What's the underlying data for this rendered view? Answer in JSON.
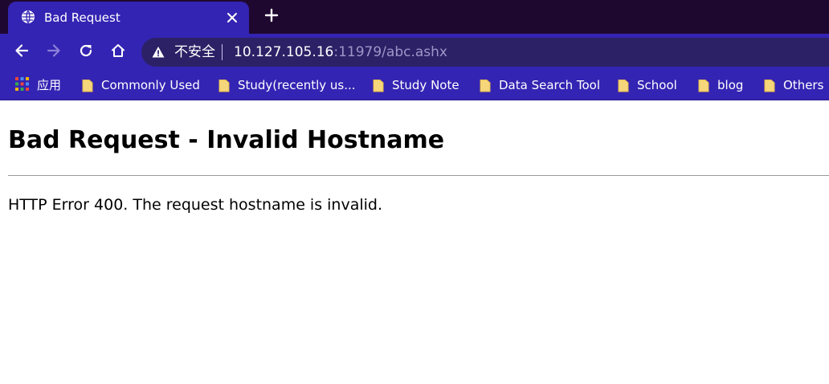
{
  "colors": {
    "tab_strip": "#1f0830",
    "toolbar": "#3424b3",
    "omnibox": "#2c2166",
    "url_dim": "#9e96c9",
    "folder": "#f6d67a"
  },
  "tab": {
    "title": "Bad Request",
    "favicon": "globe-icon",
    "close_icon": "close-icon",
    "new_tab_icon": "plus-icon"
  },
  "toolbar": {
    "back_icon": "arrow-left-icon",
    "forward_icon": "arrow-right-icon",
    "reload_icon": "reload-icon",
    "home_icon": "home-icon"
  },
  "omnibox": {
    "security_icon": "warning-icon",
    "security_label": "不安全",
    "url_host": "10.127.105.16",
    "url_rest": ":11979/abc.ashx"
  },
  "bookmarks": {
    "apps": {
      "icon": "apps-grid-icon",
      "label": "应用"
    },
    "items": [
      {
        "icon": "folder-icon",
        "label": "Commonly Used"
      },
      {
        "icon": "folder-icon",
        "label": "Study(recently us..."
      },
      {
        "icon": "folder-icon",
        "label": "Study Note"
      },
      {
        "icon": "folder-icon",
        "label": "Data Search Tool"
      },
      {
        "icon": "folder-icon",
        "label": "School"
      },
      {
        "icon": "folder-icon",
        "label": "blog"
      },
      {
        "icon": "folder-icon",
        "label": "Others"
      }
    ]
  },
  "page": {
    "heading": "Bad Request - Invalid Hostname",
    "message": "HTTP Error 400. The request hostname is invalid."
  }
}
